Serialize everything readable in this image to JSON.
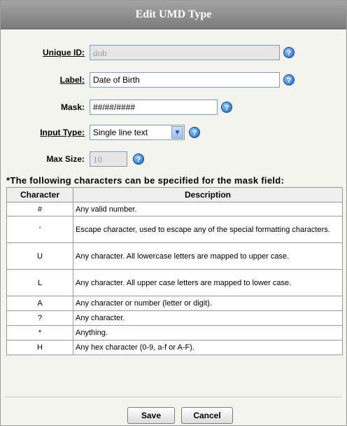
{
  "dialog": {
    "title": "Edit UMD Type"
  },
  "form": {
    "unique_id": {
      "label": "Unique ID:",
      "value": "dob"
    },
    "label": {
      "label": "Label:",
      "value": "Date of Birth"
    },
    "mask": {
      "label": "Mask:",
      "value": "##/##/####"
    },
    "input_type": {
      "label": "Input Type:",
      "value": "Single line text"
    },
    "max_size": {
      "label": "Max Size:",
      "value": "10"
    },
    "help_icon": "?"
  },
  "mask_help": {
    "caption": "*The following characters can be specified for the mask field:",
    "headers": [
      "Character",
      "Description"
    ],
    "rows": [
      [
        "#",
        "Any valid number."
      ],
      [
        "'",
        "Escape character, used to escape any of the special formatting characters."
      ],
      [
        "U",
        "Any character. All lowercase letters are mapped to upper case."
      ],
      [
        "L",
        "Any character. All upper case letters are mapped to lower case."
      ],
      [
        "A",
        "Any character or number (letter or digit)."
      ],
      [
        "?",
        "Any character."
      ],
      [
        "*",
        "Anything."
      ],
      [
        "H",
        "Any hex character (0-9, a-f or A-F)."
      ]
    ]
  },
  "buttons": {
    "save": "Save",
    "cancel": "Cancel"
  }
}
